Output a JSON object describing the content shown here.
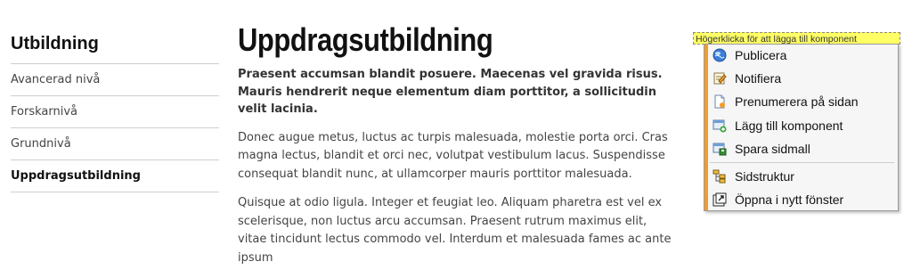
{
  "sidebar": {
    "title": "Utbildning",
    "items": [
      {
        "label": "Avancerad nivå",
        "active": false
      },
      {
        "label": "Forskarnivå",
        "active": false
      },
      {
        "label": "Grundnivå",
        "active": false
      },
      {
        "label": "Uppdragsutbildning",
        "active": true
      }
    ]
  },
  "main": {
    "title": "Uppdragsutbildning",
    "lead": "Praesent accumsan blandit posuere. Maecenas vel gravida risus. Mauris hendrerit neque elementum diam porttitor, a sollicitudin velit lacinia.",
    "paragraphs": [
      "Donec augue metus, luctus ac turpis malesuada, molestie porta orci. Cras magna lectus, blandit et orci nec, volutpat vestibulum lacus. Suspendisse consequat blandit nunc, at ullamcorper mauris porttitor malesuada.",
      "Quisque at odio ligula. Integer et feugiat leo. Aliquam pharetra est vel ex scelerisque, non luctus arcu accumsan. Praesent rutrum maximus elit, vitae tincidunt lectus commodo vel. Interdum et malesuada fames ac ante ipsum"
    ]
  },
  "context": {
    "hint": "Högerklicka för att lägga till komponent",
    "menu": [
      {
        "label": "Publicera",
        "icon": "publish-globe-icon"
      },
      {
        "label": "Notifiera",
        "icon": "notify-note-icon"
      },
      {
        "label": "Prenumerera på sidan",
        "icon": "subscribe-page-icon"
      },
      {
        "label": "Lägg till komponent",
        "icon": "add-component-icon"
      },
      {
        "label": "Spara sidmall",
        "icon": "save-template-icon"
      },
      {
        "label": "Sidstruktur",
        "icon": "sitemap-icon"
      },
      {
        "label": "Öppna i nytt fönster",
        "icon": "open-new-window-icon"
      }
    ],
    "accent_color": "#f39c2b",
    "hint_color": "#ffff66"
  }
}
